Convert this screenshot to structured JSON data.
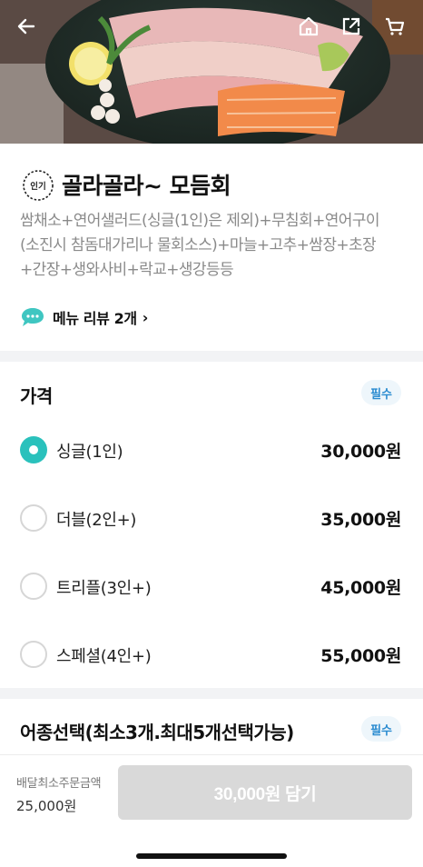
{
  "hero": {
    "image_desc": "",
    "back_icon": "arrow-left-icon",
    "home_icon": "home-icon",
    "share_icon": "share-icon",
    "cart_icon": "cart-icon"
  },
  "menu": {
    "badge": "인기",
    "title": "골라골라~ 모듬회",
    "description": "쌈채소+연어샐러드(싱글(1인)은 제외)+무침회+연어구이(소진시 참돔대가리나 물회소스)+마늘+고추+쌈장+초장+간장+생와사비+락교+생강등등",
    "review_link": "메뉴 리뷰 2개",
    "review_chevron": "›"
  },
  "price_section": {
    "title": "가격",
    "required": "필수",
    "options": [
      {
        "label": "싱글(1인)",
        "price": "30,000원",
        "selected": true
      },
      {
        "label": "더블(2인+)",
        "price": "35,000원",
        "selected": false
      },
      {
        "label": "트리플(3인+)",
        "price": "45,000원",
        "selected": false
      },
      {
        "label": "스페셜(4인+)",
        "price": "55,000원",
        "selected": false
      }
    ]
  },
  "fish_section": {
    "title": "어종선택(최소3개.최대5개선택가능)",
    "required": "필수"
  },
  "bottom": {
    "min_order_label": "배달최소주문금액",
    "min_order_value": "25,000원",
    "add_button": "30,000원 담기"
  },
  "colors": {
    "accent": "#2ac1bc",
    "badge_text": "#2a8bd0",
    "badge_bg": "#eef6fb",
    "disabled_button": "#d9d9d9"
  }
}
